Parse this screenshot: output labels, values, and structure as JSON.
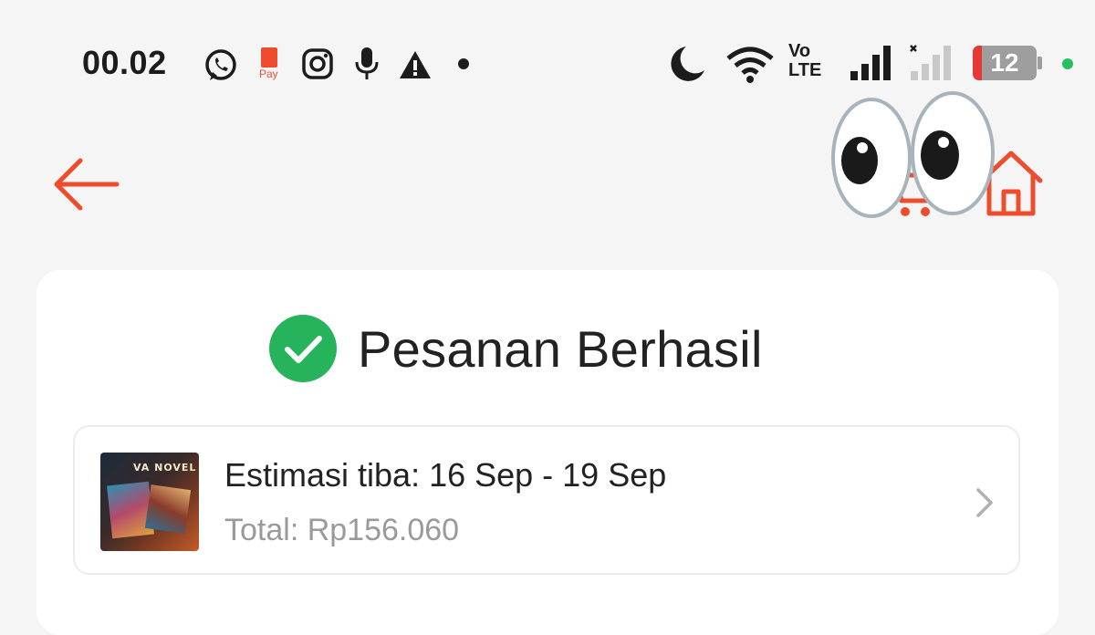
{
  "status_bar": {
    "time": "00.02",
    "notification_icons": [
      "whatsapp-icon",
      "shopeepay-icon",
      "instagram-icon",
      "microphone-icon",
      "warning-icon",
      "dot-icon"
    ],
    "shopeepay_text": "Pay",
    "system_icons": [
      "moon-icon",
      "wifi-icon",
      "volte-icon",
      "signal-icon",
      "signal-nosim-icon",
      "battery-icon"
    ],
    "volte_line1": "Vo",
    "volte_line2": "LTE",
    "battery_level": "12"
  },
  "nav": {
    "icons": [
      "back-arrow-icon",
      "cart-icon",
      "home-icon"
    ]
  },
  "overlay": {
    "icon": "googly-eyes-icon"
  },
  "order": {
    "status_title": "Pesanan Berhasil",
    "eta_text": "Estimasi tiba: 16 Sep - 19 Sep",
    "total_text": "Total: Rp156.060",
    "product_thumb_label": "VA NOVEL"
  },
  "colors": {
    "accent": "#ee4d2d",
    "success": "#26b35c",
    "background": "#f5f5f5",
    "card": "#ffffff",
    "muted_text": "#9a9a9a"
  }
}
